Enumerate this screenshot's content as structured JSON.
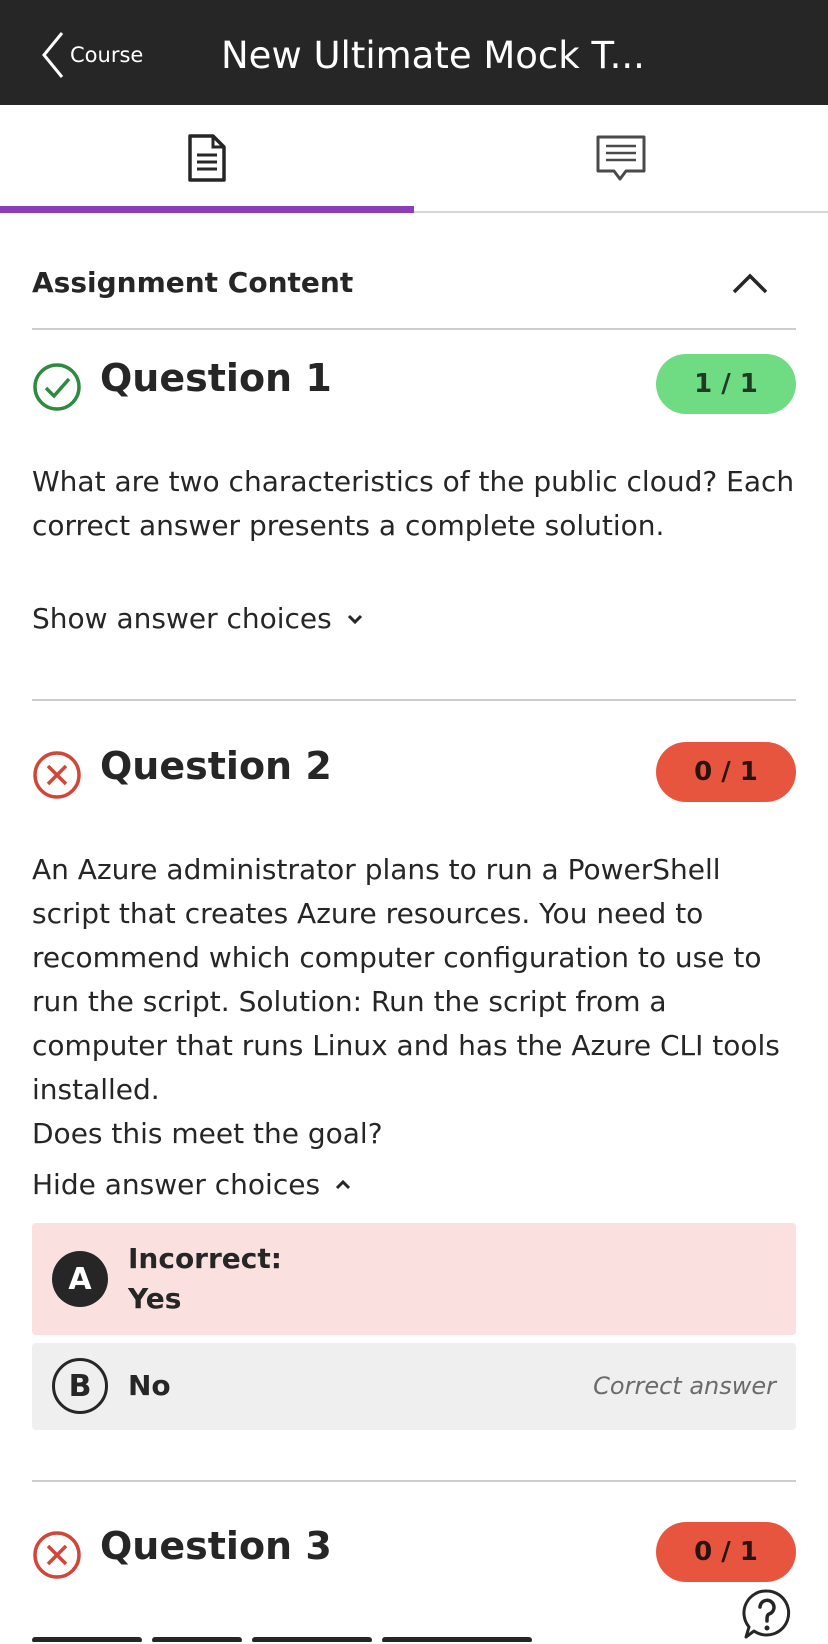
{
  "topbar": {
    "back_label": "Course",
    "title": "New Ultimate Mock T..."
  },
  "tabs": [
    {
      "name": "content",
      "icon": "document-icon",
      "active": true
    },
    {
      "name": "discussion",
      "icon": "comment-icon",
      "active": false
    }
  ],
  "section": {
    "title": "Assignment Content"
  },
  "questions": [
    {
      "title": "Question 1",
      "status": "correct",
      "score": "1 / 1",
      "text": "What are two characteristics of the public cloud? Each correct answer presents a complete solution.",
      "toggle_label": "Show answer choices"
    },
    {
      "title": "Question 2",
      "status": "incorrect",
      "score": "0 / 1",
      "text": "An Azure administrator plans to run a PowerShell script that creates Azure resources. You need to recommend which computer configuration to use to run the script. Solution: Run the script from a computer that runs Linux and has the Azure CLI tools installed.\nDoes this meet the goal?",
      "toggle_label": "Hide answer choices",
      "choices": [
        {
          "letter": "A",
          "prefix": "Incorrect:",
          "text": "Yes",
          "note": ""
        },
        {
          "letter": "B",
          "prefix": "",
          "text": "No",
          "note": "Correct answer"
        }
      ]
    },
    {
      "title": "Question 3",
      "status": "incorrect",
      "score": "0 / 1"
    }
  ],
  "colors": {
    "accent": "#8a3fb8",
    "correct": "#2e8a3e",
    "incorrect": "#d0473a",
    "topbar": "#262626"
  }
}
